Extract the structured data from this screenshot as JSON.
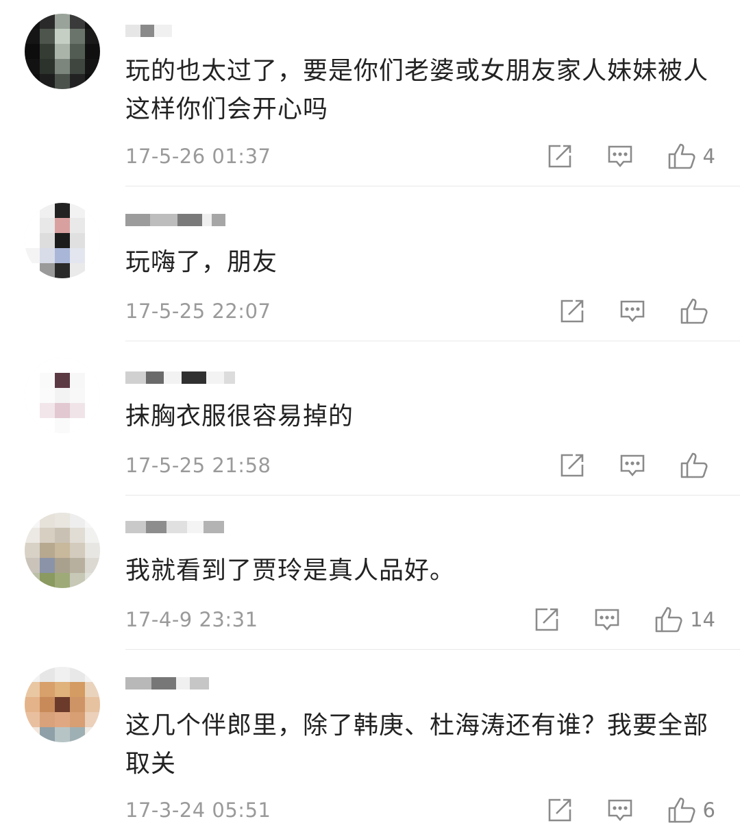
{
  "comments": [
    {
      "text": "玩的也太过了，要是你们老婆或女朋友家人妹妹被人这样你们会开心吗",
      "date": "17-5-26 01:37",
      "likes": "4"
    },
    {
      "text": "玩嗨了，朋友",
      "date": "17-5-25 22:07",
      "likes": ""
    },
    {
      "text": "抹胸衣服很容易掉的",
      "date": "17-5-25 21:58",
      "likes": ""
    },
    {
      "text": "我就看到了贾玲是真人品好。",
      "date": "17-4-9 23:31",
      "likes": "14"
    },
    {
      "text": "这几个伴郎里，除了韩庚、杜海涛还有谁？我要全部取关",
      "date": "17-3-24 05:51",
      "likes": "6"
    }
  ],
  "icons": {
    "share": "share-icon",
    "reply": "comment-icon",
    "like": "thumbs-up-icon"
  },
  "colors": {
    "text": "#222222",
    "meta": "#9a9a9a",
    "icon": "#888888",
    "divider": "#e8e8e8"
  }
}
